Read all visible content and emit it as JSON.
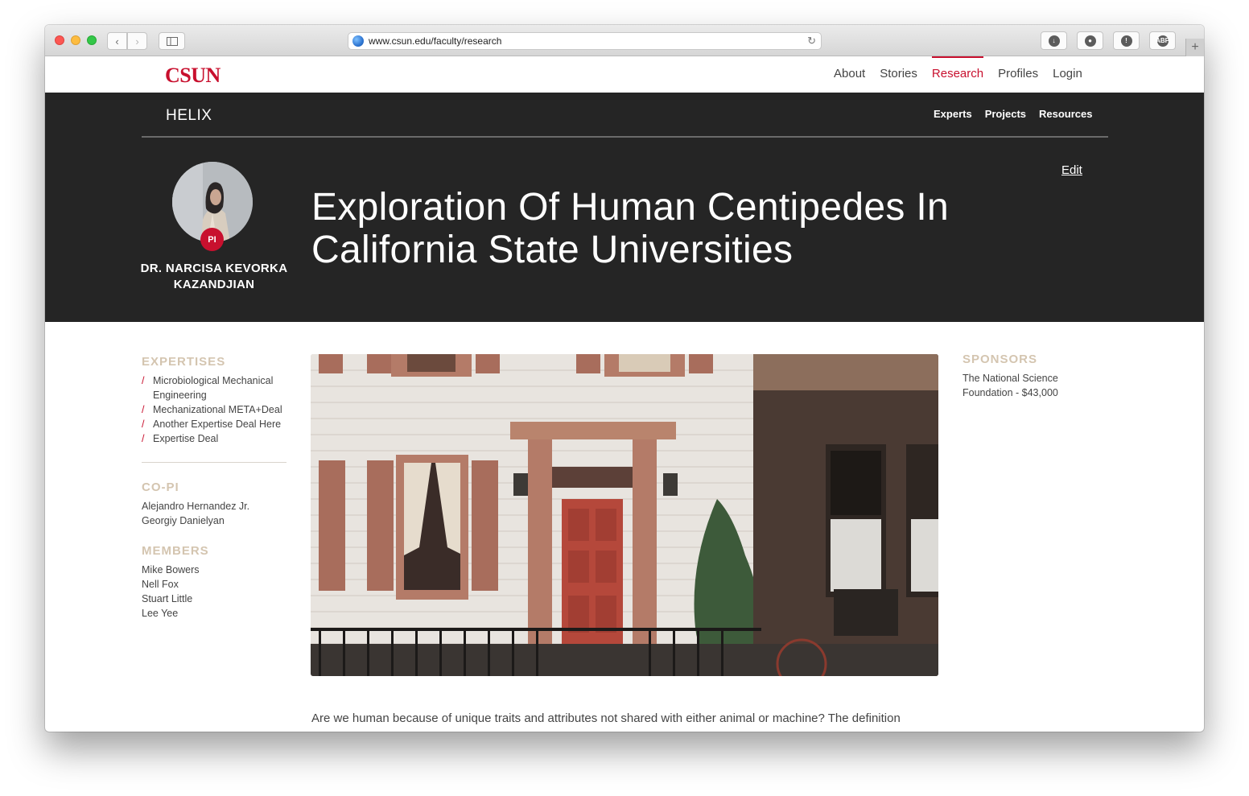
{
  "browser": {
    "url": "www.csun.edu/faculty/research",
    "new_tab_label": "+"
  },
  "site": {
    "logo": "CSUN",
    "nav": [
      {
        "label": "About",
        "active": false
      },
      {
        "label": "Stories",
        "active": false
      },
      {
        "label": "Research",
        "active": true
      },
      {
        "label": "Profiles",
        "active": false
      },
      {
        "label": "Login",
        "active": false
      }
    ],
    "accent_color": "#c8102e"
  },
  "hero": {
    "section_title": "HELIX",
    "sub_nav": [
      "Experts",
      "Projects",
      "Resources"
    ],
    "pi_badge": "PI",
    "pi_name": "DR. NARCISA KEVORKA KAZANDJIAN",
    "edit_label": "Edit",
    "project_title": "Exploration Of Human Centipedes In California State Universities",
    "background_color": "#252525"
  },
  "sidebar": {
    "expertises_heading": "EXPERTISES",
    "expertises": [
      "Microbiological Mechanical Engineering",
      "Mechanizational META+Deal",
      "Another Expertise Deal Here",
      "Expertise Deal"
    ],
    "copi_heading": "CO-PI",
    "copi": [
      "Alejandro Hernandez Jr.",
      "Georgiy Danielyan"
    ],
    "members_heading": "MEMBERS",
    "members": [
      "Mike Bowers",
      "Nell Fox",
      "Stuart Little",
      "Lee Yee"
    ]
  },
  "sponsors": {
    "heading": "SPONSORS",
    "text": "The National Science Foundation - $43,000"
  },
  "content": {
    "intro": "Are we human because of unique traits and attributes not shared with either animal or machine? The definition"
  }
}
